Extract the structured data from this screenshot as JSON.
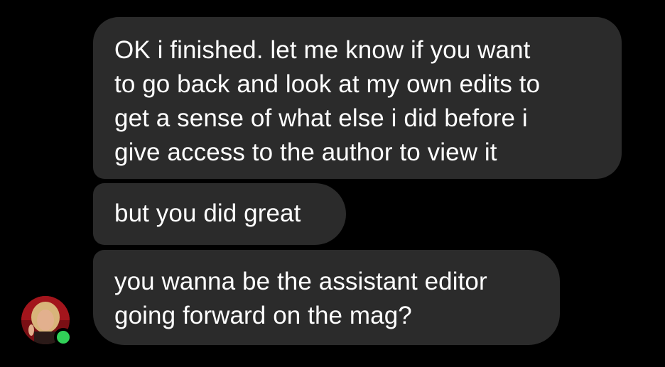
{
  "messages": [
    {
      "text": "OK i finished. let me know if you want\nto go back and look at my own edits to\nget a sense of what else i did before i\ngive access to the author to view it"
    },
    {
      "text": "but you did great"
    },
    {
      "text": "you wanna be the assistant editor\ngoing forward on the mag?"
    }
  ],
  "sender": {
    "avatar_icon": "user-avatar",
    "online": true,
    "presence_color": "#31d158"
  },
  "colors": {
    "background": "#000000",
    "bubble": "#2b2b2b",
    "text": "#ffffff"
  }
}
